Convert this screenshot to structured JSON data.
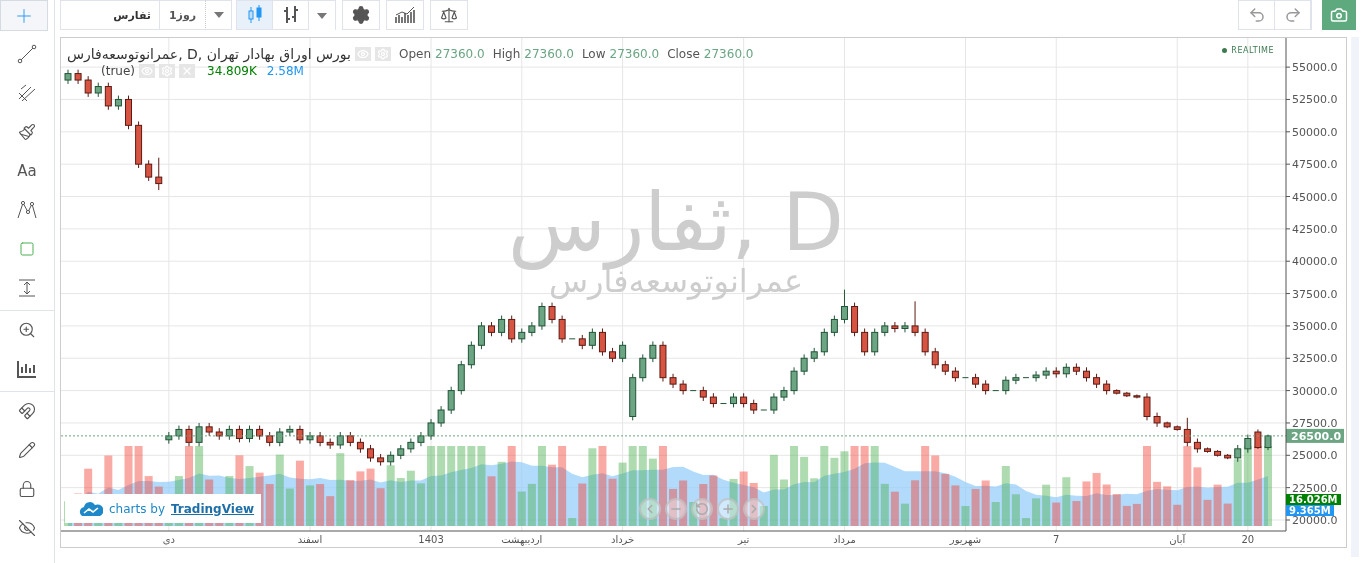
{
  "top_toolbar": {
    "symbol_field": {
      "value": "ثفارس"
    },
    "interval": {
      "value": "1روز"
    },
    "chart_type_buttons": [
      {
        "kind": "candles",
        "selected": true
      },
      {
        "kind": "bars",
        "selected": false
      }
    ],
    "tool_buttons": [
      {
        "kind": "settings"
      },
      {
        "kind": "indicators"
      },
      {
        "kind": "compare"
      }
    ],
    "history_buttons": [
      {
        "kind": "undo"
      },
      {
        "kind": "redo"
      }
    ],
    "snapshot_button": {
      "kind": "camera"
    }
  },
  "left_toolbar": {
    "groups": [
      {
        "items": [
          {
            "kind": "crosshair",
            "selected": true
          },
          {
            "kind": "line",
            "selected": false
          },
          {
            "kind": "fib",
            "selected": false
          },
          {
            "kind": "brush",
            "selected": false
          },
          {
            "kind": "text",
            "label": "Aa",
            "selected": false
          },
          {
            "kind": "pattern",
            "selected": false
          },
          {
            "kind": "rectangle",
            "selected": false
          },
          {
            "kind": "measure",
            "selected": false
          }
        ]
      },
      {
        "items": [
          {
            "kind": "zoom",
            "selected": false
          },
          {
            "kind": "ruler",
            "selected": false
          }
        ]
      },
      {
        "items": [
          {
            "kind": "magnet",
            "selected": false
          },
          {
            "kind": "pencil",
            "selected": false
          },
          {
            "kind": "lock",
            "selected": false
          },
          {
            "kind": "hide",
            "selected": false
          }
        ]
      }
    ]
  },
  "legend": {
    "title": "عمرانوتوسعه‌فارس, D, بورس اوراق بهادار تهران",
    "ohlc": [
      {
        "label": "Open",
        "value": "27360.0"
      },
      {
        "label": "High",
        "value": "27360.0"
      },
      {
        "label": "Low",
        "value": "27360.0"
      },
      {
        "label": "Close",
        "value": "27360.0"
      }
    ],
    "volume": {
      "label": "(true)",
      "values": [
        {
          "text": "34.809K",
          "color": "#008000"
        },
        {
          "text": "2.58M",
          "color": "#2196f3"
        }
      ]
    }
  },
  "realtime_badge": {
    "label": "REALTIME"
  },
  "watermark": {
    "symbol": "ثفارس, D",
    "name": "عمرانوتوسعه‌فارس"
  },
  "chart_data": {
    "type": "candlestick",
    "grid": true,
    "ylim": [
      19150,
      57250
    ],
    "yticks": [
      {
        "value": 55000,
        "label": "55000.0"
      },
      {
        "value": 52500,
        "label": "52500.0"
      },
      {
        "value": 50000,
        "label": "50000.0"
      },
      {
        "value": 47500,
        "label": "47500.0"
      },
      {
        "value": 45000,
        "label": "45000.0"
      },
      {
        "value": 42500,
        "label": "42500.0"
      },
      {
        "value": 40000,
        "label": "40000.0"
      },
      {
        "value": 37500,
        "label": "37500.0"
      },
      {
        "value": 35000,
        "label": "35000.0"
      },
      {
        "value": 32500,
        "label": "32500.0"
      },
      {
        "value": 30000,
        "label": "30000.0"
      },
      {
        "value": 27500,
        "label": "27500.0"
      },
      {
        "value": 25000,
        "label": "25000.0"
      },
      {
        "value": 22500,
        "label": "22500.0"
      },
      {
        "value": 20000,
        "label": "20000.0"
      }
    ],
    "categories": [
      null,
      null,
      null,
      null,
      null,
      null,
      null,
      null,
      null,
      null,
      "دی",
      null,
      null,
      null,
      null,
      null,
      null,
      null,
      null,
      null,
      null,
      null,
      null,
      null,
      "اسفند",
      null,
      null,
      null,
      null,
      null,
      null,
      null,
      null,
      null,
      null,
      null,
      "1403",
      null,
      null,
      null,
      null,
      null,
      null,
      null,
      null,
      "اردیبهشت",
      null,
      null,
      null,
      null,
      null,
      null,
      null,
      null,
      null,
      "خرداد",
      null,
      null,
      null,
      null,
      null,
      null,
      null,
      null,
      null,
      null,
      null,
      "تیر",
      null,
      null,
      null,
      null,
      null,
      null,
      null,
      null,
      null,
      "مرداد",
      null,
      null,
      null,
      null,
      null,
      null,
      null,
      null,
      null,
      null,
      null,
      "شهریور",
      null,
      null,
      null,
      null,
      null,
      null,
      null,
      null,
      "7",
      null,
      null,
      null,
      null,
      null,
      null,
      null,
      null,
      null,
      null,
      null,
      "آبان",
      null,
      null,
      null,
      null,
      null,
      null,
      "20",
      null,
      null
    ],
    "ohlc": [
      [
        54000,
        54800,
        53700,
        54500
      ],
      [
        54500,
        54800,
        53700,
        54000
      ],
      [
        54000,
        54300,
        52700,
        53000
      ],
      [
        53000,
        53800,
        52700,
        53500
      ],
      [
        53500,
        53800,
        51700,
        52000
      ],
      [
        52000,
        52800,
        51700,
        52500
      ],
      [
        52500,
        52800,
        50200,
        50500
      ],
      [
        50500,
        50800,
        47200,
        47500
      ],
      [
        47500,
        47800,
        46200,
        46500
      ],
      [
        46500,
        48000,
        45500,
        46000
      ],
      [
        26200,
        26800,
        25900,
        26500
      ],
      [
        26500,
        27300,
        26200,
        27000
      ],
      [
        27000,
        27300,
        25700,
        26000
      ],
      [
        26000,
        27500,
        25700,
        27200
      ],
      [
        27200,
        27500,
        26500,
        26800
      ],
      [
        26800,
        27100,
        26200,
        26500
      ],
      [
        26500,
        27300,
        26200,
        27000
      ],
      [
        27000,
        27300,
        26000,
        26300
      ],
      [
        26300,
        27300,
        26000,
        27000
      ],
      [
        27000,
        27300,
        26200,
        26500
      ],
      [
        26500,
        26800,
        25700,
        26000
      ],
      [
        26000,
        27100,
        25700,
        26800
      ],
      [
        26800,
        27300,
        26500,
        27000
      ],
      [
        27000,
        27300,
        25900,
        26200
      ],
      [
        26200,
        26800,
        25900,
        26500
      ],
      [
        26500,
        26800,
        25700,
        26000
      ],
      [
        26000,
        26300,
        25500,
        25800
      ],
      [
        25800,
        26800,
        25500,
        26500
      ],
      [
        26500,
        26800,
        25700,
        26000
      ],
      [
        26000,
        26300,
        25200,
        25500
      ],
      [
        25500,
        25800,
        24500,
        24800
      ],
      [
        24800,
        25100,
        24200,
        24500
      ],
      [
        24500,
        25300,
        24200,
        25000
      ],
      [
        25000,
        25800,
        24700,
        25500
      ],
      [
        25500,
        26300,
        25200,
        26000
      ],
      [
        26000,
        26800,
        25700,
        26500
      ],
      [
        26500,
        27800,
        26200,
        27500
      ],
      [
        27500,
        28800,
        27200,
        28500
      ],
      [
        28500,
        30300,
        28200,
        30000
      ],
      [
        30000,
        32300,
        29700,
        32000
      ],
      [
        32000,
        33800,
        31700,
        33500
      ],
      [
        33500,
        35300,
        33200,
        35000
      ],
      [
        35000,
        35300,
        34200,
        34500
      ],
      [
        34500,
        35800,
        34200,
        35500
      ],
      [
        35500,
        35800,
        33700,
        34000
      ],
      [
        34000,
        34800,
        33700,
        34500
      ],
      [
        34500,
        35300,
        34200,
        35000
      ],
      [
        35000,
        36800,
        34700,
        36500
      ],
      [
        36500,
        36800,
        35200,
        35500
      ],
      [
        35500,
        35800,
        33700,
        34000
      ],
      [
        34000,
        34000,
        34000,
        34000
      ],
      [
        34000,
        34300,
        33200,
        33500
      ],
      [
        33500,
        34800,
        33200,
        34500
      ],
      [
        34500,
        34800,
        32700,
        33000
      ],
      [
        33000,
        33300,
        32200,
        32500
      ],
      [
        32500,
        33800,
        32200,
        33500
      ],
      [
        28000,
        31300,
        27700,
        31000
      ],
      [
        31000,
        32800,
        30700,
        32500
      ],
      [
        32500,
        33800,
        32200,
        33500
      ],
      [
        33500,
        33800,
        30700,
        31000
      ],
      [
        31000,
        31300,
        30200,
        30500
      ],
      [
        30500,
        30800,
        29700,
        30000
      ],
      [
        30000,
        30000,
        30000,
        30000
      ],
      [
        30000,
        30300,
        29200,
        29500
      ],
      [
        29500,
        29800,
        28700,
        29000
      ],
      [
        29000,
        29000,
        29000,
        29000
      ],
      [
        29000,
        29800,
        28700,
        29500
      ],
      [
        29500,
        29800,
        28700,
        29000
      ],
      [
        29000,
        29300,
        28200,
        28500
      ],
      [
        28500,
        28500,
        28500,
        28500
      ],
      [
        28500,
        29800,
        28200,
        29500
      ],
      [
        29500,
        30300,
        29200,
        30000
      ],
      [
        30000,
        31800,
        29700,
        31500
      ],
      [
        31500,
        32800,
        31200,
        32500
      ],
      [
        32500,
        33300,
        32200,
        33000
      ],
      [
        33000,
        34800,
        32700,
        34500
      ],
      [
        34500,
        35800,
        34200,
        35500
      ],
      [
        35500,
        37800,
        35200,
        36500
      ],
      [
        36500,
        36800,
        34200,
        34500
      ],
      [
        34500,
        34800,
        32700,
        33000
      ],
      [
        33000,
        34800,
        32700,
        34500
      ],
      [
        34500,
        35300,
        34200,
        35000
      ],
      [
        35000,
        35300,
        34500,
        34800
      ],
      [
        34800,
        35300,
        34500,
        35000
      ],
      [
        35000,
        36900,
        34200,
        34500
      ],
      [
        34500,
        34800,
        32700,
        33000
      ],
      [
        33000,
        33300,
        31700,
        32000
      ],
      [
        32000,
        32300,
        31200,
        31500
      ],
      [
        31500,
        31800,
        30700,
        31000
      ],
      [
        31000,
        31000,
        31000,
        31000
      ],
      [
        31000,
        31300,
        30200,
        30500
      ],
      [
        30500,
        30800,
        29700,
        30000
      ],
      [
        30000,
        30000,
        30000,
        30000
      ],
      [
        30000,
        31100,
        29700,
        30800
      ],
      [
        30800,
        31300,
        30500,
        31000
      ],
      [
        31000,
        31000,
        31000,
        31000
      ],
      [
        31000,
        31500,
        30700,
        31200
      ],
      [
        31200,
        31800,
        30900,
        31500
      ],
      [
        31500,
        31800,
        31000,
        31300
      ],
      [
        31300,
        32100,
        31000,
        31800
      ],
      [
        31800,
        32100,
        31200,
        31500
      ],
      [
        31500,
        31800,
        30700,
        31000
      ],
      [
        31000,
        31300,
        30200,
        30500
      ],
      [
        30500,
        30800,
        29700,
        30000
      ],
      [
        30000,
        30100,
        29700,
        29800
      ],
      [
        29800,
        29900,
        29500,
        29600
      ],
      [
        29600,
        29700,
        29400,
        29500
      ],
      [
        29500,
        29800,
        27700,
        28000
      ],
      [
        28000,
        28300,
        27200,
        27500
      ],
      [
        27500,
        27600,
        27100,
        27200
      ],
      [
        27200,
        27300,
        26900,
        27000
      ],
      [
        27000,
        27900,
        25700,
        26000
      ],
      [
        26000,
        26300,
        25200,
        25500
      ],
      [
        25500,
        25600,
        25200,
        25300
      ],
      [
        25300,
        25400,
        24900,
        25000
      ],
      [
        25000,
        25100,
        24700,
        24800
      ],
      [
        24800,
        25800,
        24500,
        25500
      ],
      [
        25500,
        26600,
        25200,
        26300
      ],
      [
        26800,
        27000,
        25500,
        25600
      ],
      [
        25600,
        26600,
        25400,
        26500
      ]
    ],
    "ref_lines": [
      {
        "axis": "y",
        "value": 26500,
        "label": "26500.0",
        "color": "#6ba583"
      }
    ]
  },
  "volume_tags": [
    {
      "label": "16.026M",
      "color": "#008000"
    },
    {
      "label": "9.365M",
      "color": "#2196f3"
    }
  ],
  "branding": {
    "prefix": "charts by",
    "name": "TradingView"
  },
  "nav_buttons": [
    {
      "kind": "left"
    },
    {
      "kind": "minus"
    },
    {
      "kind": "reset"
    },
    {
      "kind": "plus"
    },
    {
      "kind": "right"
    }
  ]
}
